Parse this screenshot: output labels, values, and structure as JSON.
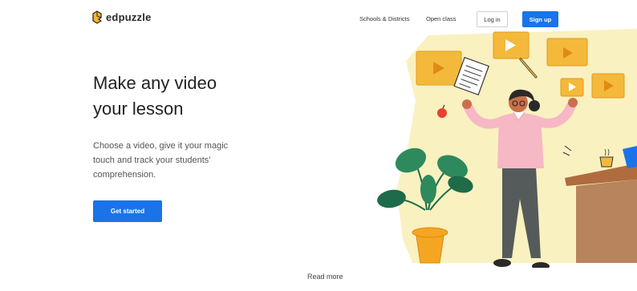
{
  "header": {
    "logo_text": "edpuzzle",
    "logo_icon": "puzzle-piece-icon",
    "nav": {
      "schools": "Schools & Districts",
      "open_class": "Open class",
      "login": "Log in",
      "signup": "Sign up"
    }
  },
  "hero": {
    "title_line1": "Make any video",
    "title_line2": "your lesson",
    "description": "Choose a video, give it your magic touch and track your students' comprehension.",
    "cta": "Get started"
  },
  "footer": {
    "read_more": "Read more"
  },
  "colors": {
    "accent": "#1a73e8",
    "logo_yellow": "#f5b82e",
    "illustration_bg": "#faf1c0",
    "video_card": "#f4b93a",
    "shirt_pink": "#f6b8c4"
  },
  "illustration_icons": [
    "video-card-icon",
    "clipboard-icon",
    "pencil-icon",
    "apple-icon",
    "plant-icon",
    "teacher-figure",
    "desk-icon",
    "coffee-cup-icon",
    "laptop-icon"
  ]
}
